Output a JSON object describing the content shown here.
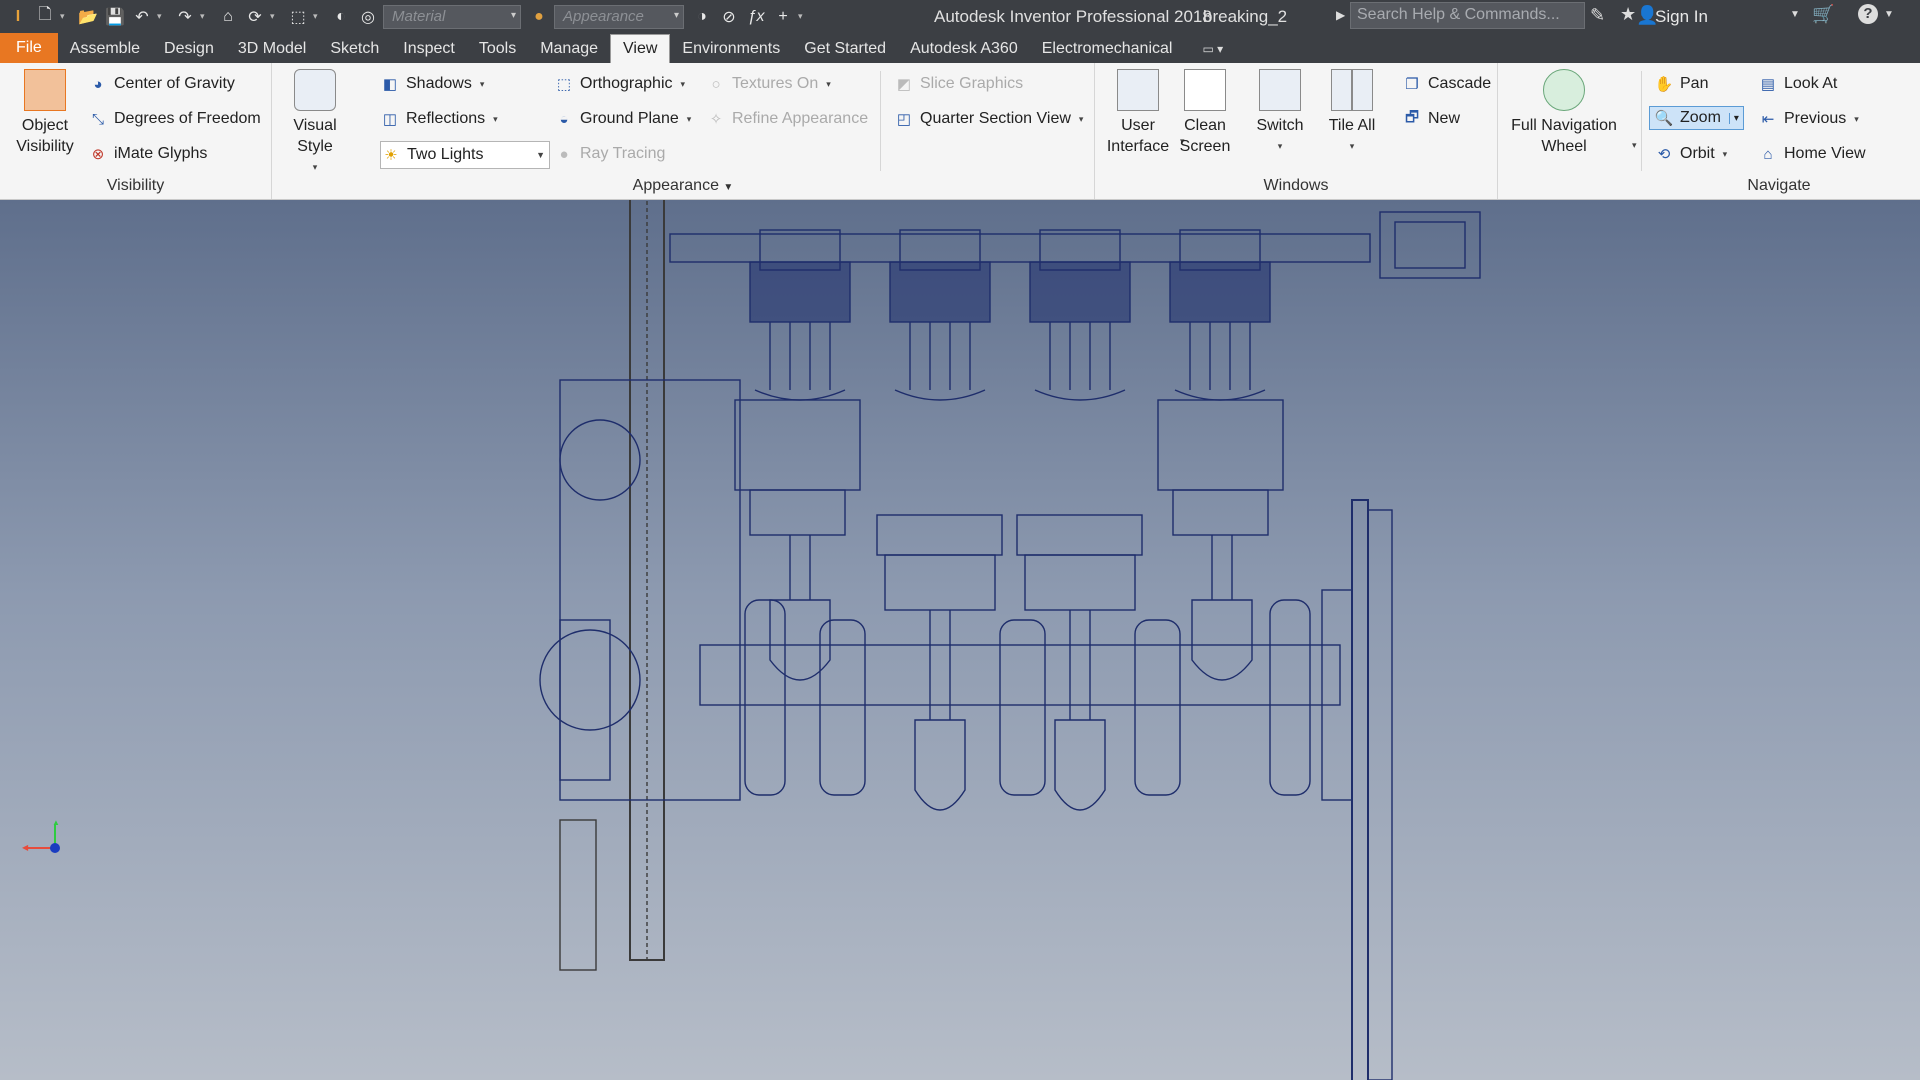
{
  "title_bar": {
    "app_title": "Autodesk Inventor Professional 2018",
    "document_name": "breaking_2",
    "material_placeholder": "Material",
    "appearance_placeholder": "Appearance",
    "search_placeholder": "Search Help & Commands...",
    "sign_in": "Sign In"
  },
  "tabs": [
    "File",
    "Assemble",
    "Design",
    "3D Model",
    "Sketch",
    "Inspect",
    "Tools",
    "Manage",
    "View",
    "Environments",
    "Get Started",
    "Autodesk A360",
    "Electromechanical"
  ],
  "active_tab": "View",
  "ribbon": {
    "visibility": {
      "title": "Visibility",
      "object_visibility": "Object Visibility",
      "center_of_gravity": "Center of Gravity",
      "degrees_of_freedom": "Degrees of Freedom",
      "imate_glyphs": "iMate Glyphs"
    },
    "appearance": {
      "title": "Appearance",
      "visual_style": "Visual Style",
      "shadows": "Shadows",
      "reflections": "Reflections",
      "lighting": "Two Lights",
      "orthographic": "Orthographic",
      "ground_plane": "Ground Plane",
      "ray_tracing": "Ray Tracing",
      "textures_on": "Textures On",
      "refine_appearance": "Refine Appearance",
      "slice_graphics": "Slice Graphics",
      "quarter_section_view": "Quarter Section View"
    },
    "windows": {
      "title": "Windows",
      "user_interface": "User Interface",
      "clean_screen": "Clean Screen",
      "switch": "Switch",
      "tile_all": "Tile All",
      "cascade": "Cascade",
      "new": "New"
    },
    "navigate": {
      "title": "Navigate",
      "full_navigation_wheel": "Full Navigation Wheel",
      "pan": "Pan",
      "zoom": "Zoom",
      "orbit": "Orbit",
      "look_at": "Look At",
      "previous": "Previous",
      "home_view": "Home View"
    }
  },
  "colors": {
    "file_tab": "#e87722",
    "title_bar": "#3c3f44",
    "wireframe": "#1e2d6b"
  }
}
